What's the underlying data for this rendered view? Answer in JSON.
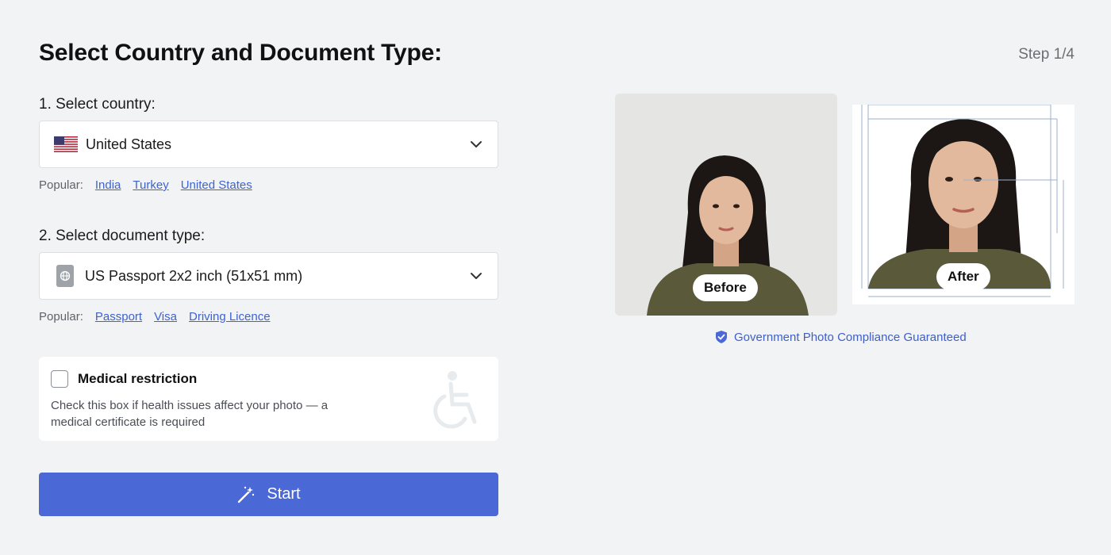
{
  "header": {
    "title": "Select Country and Document Type:",
    "step": "Step 1/4"
  },
  "country": {
    "label": "1. Select country:",
    "selected": "United States",
    "flag_icon": "us-flag-icon",
    "popular_label": "Popular:",
    "popular": [
      "India",
      "Turkey",
      "United States"
    ]
  },
  "document": {
    "label": "2. Select document type:",
    "selected": "US Passport 2x2 inch (51x51 mm)",
    "icon": "passport-icon",
    "popular_label": "Popular:",
    "popular": [
      "Passport",
      "Visa",
      "Driving Licence"
    ]
  },
  "medical": {
    "title": "Medical restriction",
    "description": "Check this box if health issues affect your photo — a medical certificate is required",
    "checked": false,
    "icon": "wheelchair-icon"
  },
  "start_button": {
    "label": "Start",
    "icon": "magic-wand-icon"
  },
  "preview": {
    "before_label": "Before",
    "after_label": "After",
    "compliance_text": "Government Photo Compliance Guaranteed",
    "compliance_icon": "shield-check-icon"
  },
  "colors": {
    "accent": "#4a68d6",
    "link": "#3e63d1",
    "background": "#f1f3f5"
  }
}
